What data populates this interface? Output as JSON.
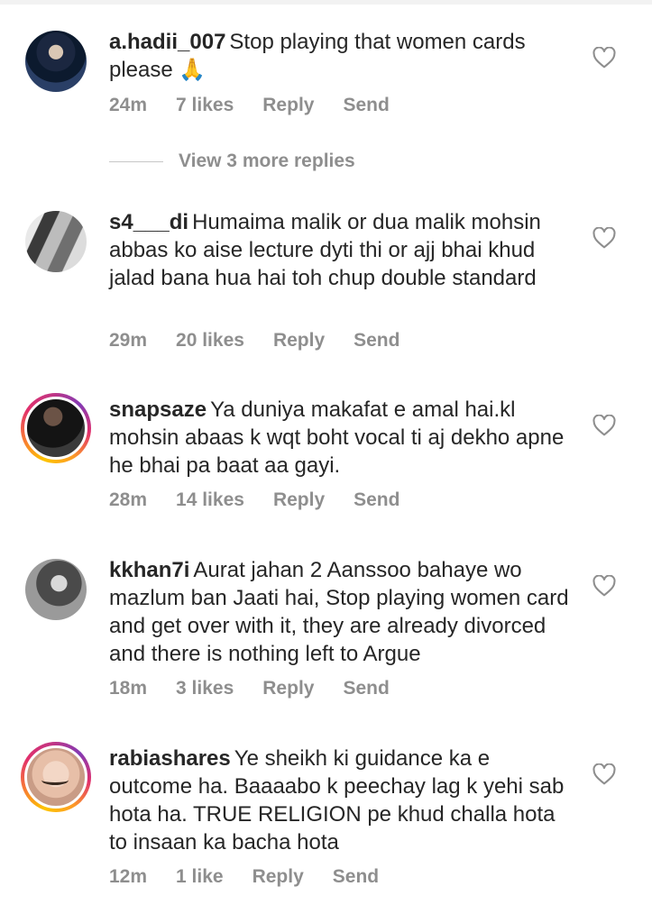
{
  "comments": [
    {
      "username": "a.hadii_007",
      "text": "Stop playing that women cards please 🙏",
      "time": "24m",
      "likes": "7 likes",
      "reply_label": "Reply",
      "send_label": "Send",
      "avatar_story_ring": false
    },
    {
      "username": "s4___di",
      "text": "Humaima malik or dua malik mohsin abbas ko aise lecture dyti thi or ajj bhai khud jalad bana hua hai toh chup double standard",
      "time": "29m",
      "likes": "20 likes",
      "reply_label": "Reply",
      "send_label": "Send",
      "avatar_story_ring": false
    },
    {
      "username": "snapsaze",
      "text": "Ya duniya makafat e amal hai.kl mohsin abaas k wqt boht vocal ti aj dekho apne he bhai pa baat aa gayi.",
      "time": "28m",
      "likes": "14 likes",
      "reply_label": "Reply",
      "send_label": "Send",
      "avatar_story_ring": true
    },
    {
      "username": "kkhan7i",
      "text": "Aurat jahan 2 Aanssoo bahaye wo mazlum ban Jaati hai, Stop playing women card and get over with it, they are already divorced and there is nothing left to Argue",
      "time": "18m",
      "likes": "3 likes",
      "reply_label": "Reply",
      "send_label": "Send",
      "avatar_story_ring": false
    },
    {
      "username": "rabiashares",
      "text": "Ye sheikh ki guidance ka e outcome ha. Baaaabo k peechay lag k yehi sab hota ha. TRUE RELIGION pe khud challa hota to insaan ka bacha hota",
      "time": "12m",
      "likes": "1 like",
      "reply_label": "Reply",
      "send_label": "Send",
      "avatar_story_ring": true
    }
  ],
  "view_replies": {
    "label": "View 3 more replies"
  },
  "icons": {
    "like": "heart-outline-icon"
  },
  "colors": {
    "text": "#262626",
    "secondary": "#8e8e8e",
    "heart": "#8e8e8e"
  }
}
